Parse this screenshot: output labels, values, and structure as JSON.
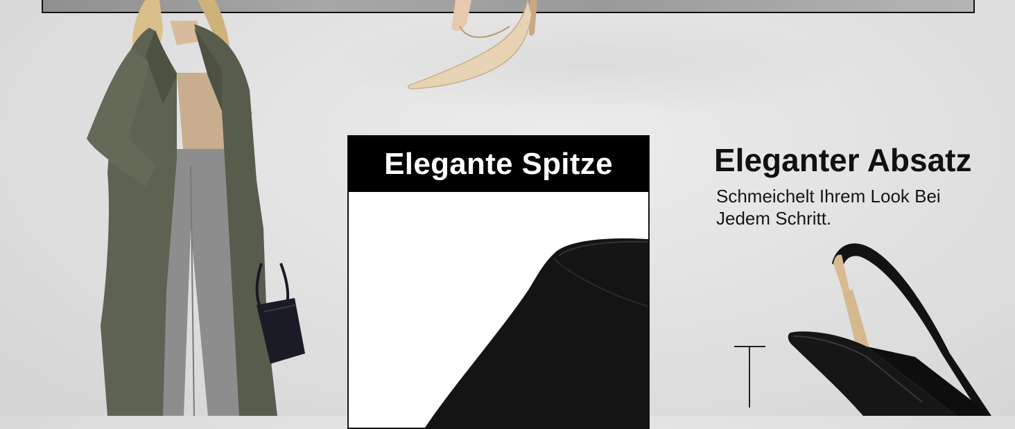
{
  "center_panel": {
    "title": "Elegante Spitze"
  },
  "right_panel": {
    "title": "Eleganter Absatz",
    "subtitle": "Schmeichelt Ihrem Look Bei Jedem Schritt."
  },
  "images": {
    "model": "woman-in-olive-trench-coat-icon",
    "nude_pump": "nude-pointed-pump-icon",
    "toe_closeup": "black-suede-toe-closeup-icon",
    "slingback": "black-slingback-heel-icon"
  },
  "colors": {
    "background": "#e2e2e2",
    "header_black": "#000000",
    "text_dark": "#111111",
    "coat_olive": "#5f6453",
    "nude": "#e6cfb0"
  }
}
